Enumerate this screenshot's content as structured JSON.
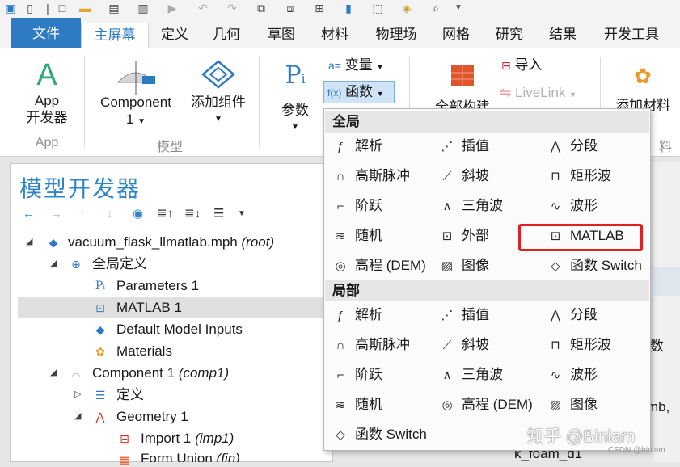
{
  "colors": {
    "accent": "#2e7bc4",
    "title_blue": "#2e86c9",
    "highlight_red": "#e02121"
  },
  "ribbon_tabs": [
    {
      "label": "文件"
    },
    {
      "label": "主屏幕"
    },
    {
      "label": "定义"
    },
    {
      "label": "几何"
    },
    {
      "label": "草图"
    },
    {
      "label": "材料"
    },
    {
      "label": "物理场"
    },
    {
      "label": "网格"
    },
    {
      "label": "研究"
    },
    {
      "label": "结果"
    },
    {
      "label": "开发工具"
    }
  ],
  "ribbon": {
    "app_dev_line1": "App",
    "app_dev_line2": "开发器",
    "component_line1": "Component",
    "component_line2": "1",
    "add_component": "添加组件",
    "parameters": "参数",
    "variables": "变量",
    "functions": "函数",
    "build_all": "全部构建",
    "import": "导入",
    "livelink": "LiveLink",
    "add_material": "添加材料",
    "group_app": "App",
    "group_model": "模型",
    "group_material_tail": "料"
  },
  "model_builder": {
    "title": "模型开发器",
    "toolbar_icons": [
      "arrow-left-icon",
      "arrow-right-icon",
      "arrow-up-icon",
      "arrow-down-icon",
      "eye-icon",
      "expand-all-icon",
      "collapse-all-icon",
      "list-options-icon"
    ],
    "tree": [
      {
        "label": "vacuum_flask_llmatlab.mph",
        "tag": "(root)"
      },
      {
        "label": "全局定义",
        "tag": ""
      },
      {
        "label": "Parameters 1",
        "tag": ""
      },
      {
        "label": "MATLAB 1",
        "tag": ""
      },
      {
        "label": "Default Model Inputs",
        "tag": ""
      },
      {
        "label": "Materials",
        "tag": ""
      },
      {
        "label": "Component 1",
        "tag": "(comp1)"
      },
      {
        "label": "定义",
        "tag": ""
      },
      {
        "label": "Geometry 1",
        "tag": ""
      },
      {
        "label": "Import 1",
        "tag": "(imp1)"
      },
      {
        "label": "Form Union",
        "tag": "(fin)"
      }
    ]
  },
  "dropdown": {
    "global_header": "全局",
    "local_header": "局部",
    "global_items": [
      {
        "label": "解析",
        "icon": "fx-analytic-icon"
      },
      {
        "label": "插值",
        "icon": "interpolation-icon"
      },
      {
        "label": "分段",
        "icon": "piecewise-icon"
      },
      {
        "label": "高斯脉冲",
        "icon": "gaussian-pulse-icon"
      },
      {
        "label": "斜坡",
        "icon": "ramp-icon"
      },
      {
        "label": "矩形波",
        "icon": "rectangle-wave-icon"
      },
      {
        "label": "阶跃",
        "icon": "step-icon"
      },
      {
        "label": "三角波",
        "icon": "triangle-wave-icon"
      },
      {
        "label": "波形",
        "icon": "waveform-icon"
      },
      {
        "label": "随机",
        "icon": "random-icon"
      },
      {
        "label": "外部",
        "icon": "external-icon"
      },
      {
        "label": "MATLAB",
        "icon": "matlab-icon"
      },
      {
        "label": "高程 (DEM)",
        "icon": "elevation-icon"
      },
      {
        "label": "图像",
        "icon": "image-icon"
      },
      {
        "label": "函数 Switch",
        "icon": "switch-icon"
      }
    ],
    "local_items": [
      {
        "label": "解析",
        "icon": "fx-analytic-icon"
      },
      {
        "label": "插值",
        "icon": "interpolation-icon"
      },
      {
        "label": "分段",
        "icon": "piecewise-icon"
      },
      {
        "label": "高斯脉冲",
        "icon": "gaussian-pulse-icon"
      },
      {
        "label": "斜坡",
        "icon": "ramp-icon"
      },
      {
        "label": "矩形波",
        "icon": "rectangle-wave-icon"
      },
      {
        "label": "阶跃",
        "icon": "step-icon"
      },
      {
        "label": "三角波",
        "icon": "triangle-wave-icon"
      },
      {
        "label": "波形",
        "icon": "waveform-icon"
      },
      {
        "label": "随机",
        "icon": "random-icon"
      },
      {
        "label": "高程 (DEM)",
        "icon": "elevation-icon"
      },
      {
        "label": "图像",
        "icon": "image-icon"
      },
      {
        "label": "函数 Switch",
        "icon": "switch-icon"
      }
    ]
  },
  "right_panel": {
    "fragment_1": "数",
    "fragment_2": "mb,",
    "fragment_3": "k_foam_d1"
  },
  "watermark": {
    "text": "知乎 @Binlam",
    "small": "CSDN @binlam"
  }
}
